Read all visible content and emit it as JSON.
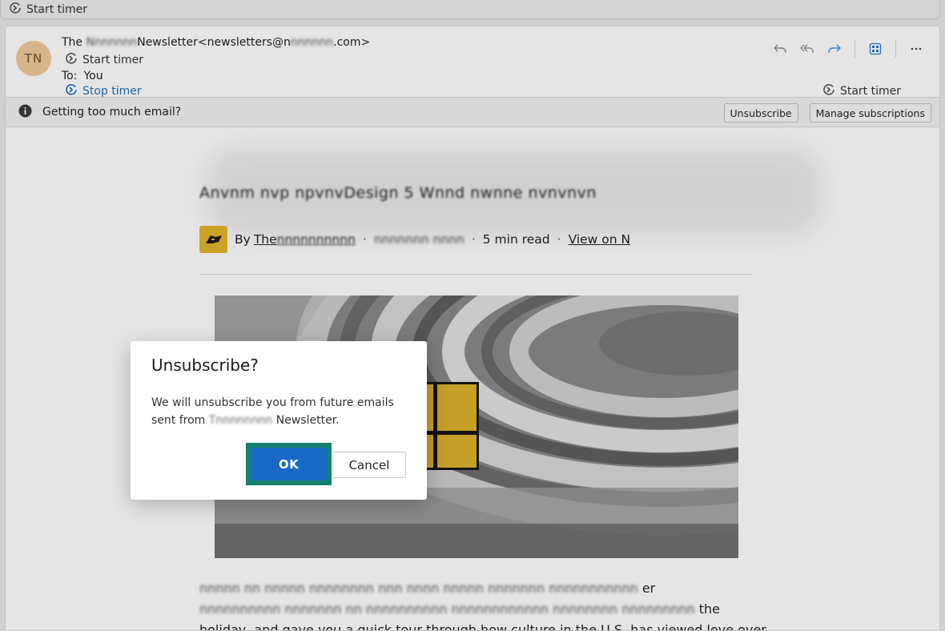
{
  "top_bar": {
    "timer_label": "Start timer"
  },
  "email": {
    "avatar_initials": "TN",
    "from_prefix": "The",
    "from_blurred": "Nnnnnnn",
    "from_suffix": "Newsletter<newsletters@n",
    "from_domain_blurred": "nnnnnn",
    "from_end": ".com>",
    "sender_timer_label": "Start timer",
    "to_label": "To:",
    "to_value": "You",
    "stop_timer_label": "Stop timer",
    "right_timer_label": "Start timer"
  },
  "infobar": {
    "message": "Getting too much email?",
    "unsubscribe_label": "Unsubscribe",
    "manage_label": "Manage subscriptions"
  },
  "article": {
    "headline_blurred": "Anvnm nvp              npvnvDesign 5 Wnnd nwnne nvnvnvn",
    "by": "By",
    "author_visible": "The",
    "author_blurred": "nnnnnnnnnn",
    "date_blurred": "nnnnnnn nnnn",
    "read_time": "5 min read",
    "view_link": "View on N",
    "line1_blurred": "nnnnn nn nnnnn nnnnnnnn nnn nnnn nnnnn nnnnnnn nnnnnnnnnnn",
    "line1_end": "er",
    "line2_blurred": "nnnnnnnnnn nnnnnnn nn nnnnnnnnnn  nnnnnnnnnnnn nnnnnnnn nnnnnnnnn",
    "line2_end": "the",
    "line3": "holiday, and gave you a quick tour through how culture in the U.S. has viewed love over"
  },
  "dialog": {
    "title": "Unsubscribe?",
    "text_before": "We will unsubscribe you from future emails sent from",
    "text_blurred": "Tnnnnnnnn",
    "text_after": "Newsletter.",
    "ok_label": "OK",
    "cancel_label": "Cancel"
  }
}
